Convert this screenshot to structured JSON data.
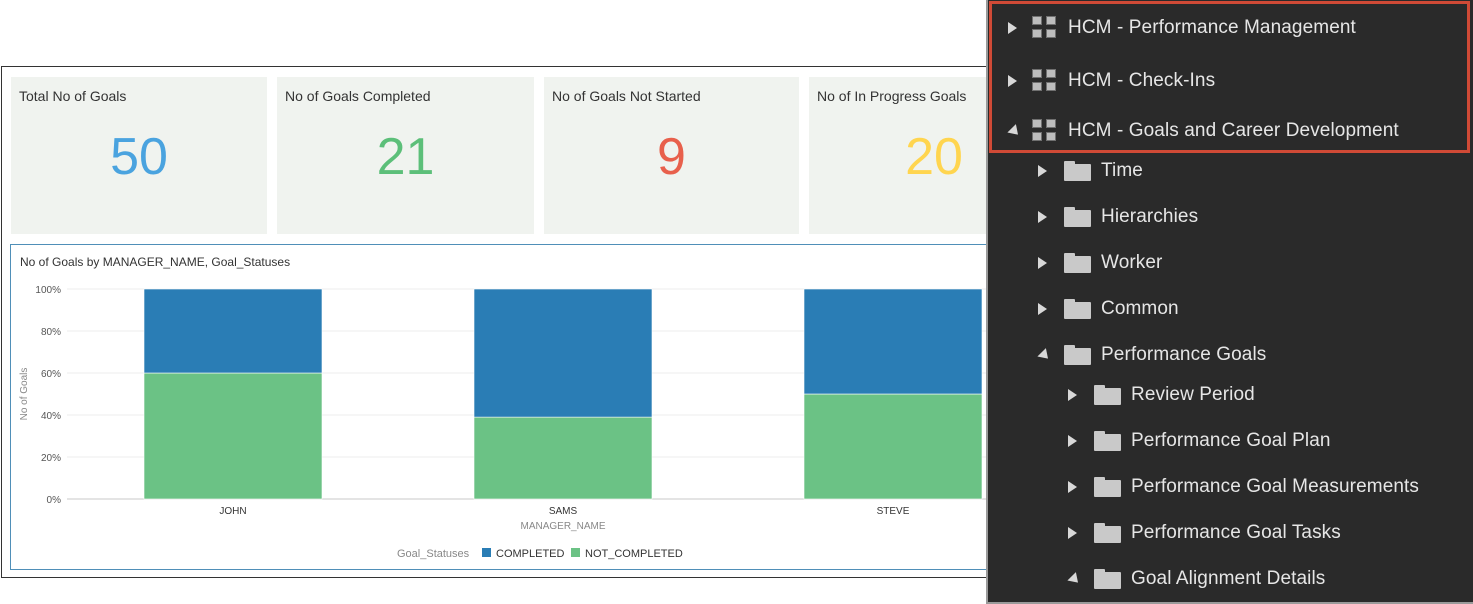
{
  "kpis": [
    {
      "title": "Total No of Goals",
      "value": "50"
    },
    {
      "title": "No of Goals Completed",
      "value": "21"
    },
    {
      "title": "No of Goals Not Started",
      "value": "9"
    },
    {
      "title": "No of In Progress Goals",
      "value": "20"
    }
  ],
  "colors": {
    "completed": "#2a7db5",
    "not_completed": "#6bc285",
    "total_goals": "#4aa3df",
    "goals_completed": "#5cbf79",
    "goals_not_started": "#e8604c",
    "in_progress": "#ffd54f",
    "highlight_border": "#d04a36"
  },
  "chart_data": {
    "type": "bar",
    "stacked": true,
    "title": "No of Goals by MANAGER_NAME, Goal_Statuses",
    "xlabel": "MANAGER_NAME",
    "ylabel": "No of Goals",
    "categories": [
      "JOHN",
      "SAMS",
      "STEVE"
    ],
    "series": [
      {
        "name": "NOT_COMPLETED",
        "values": [
          60,
          39,
          50
        ]
      },
      {
        "name": "COMPLETED",
        "values": [
          40,
          61,
          50
        ]
      }
    ],
    "ylim": [
      0,
      100
    ],
    "yticks": [
      "0%",
      "20%",
      "40%",
      "60%",
      "80%",
      "100%"
    ],
    "legend_title": "Goal_Statuses",
    "legend_position": "bottom",
    "grid": true
  },
  "tree": {
    "items": [
      {
        "label": "HCM - Performance Management",
        "icon": "subject-area-icon",
        "expanded": false,
        "level": 0
      },
      {
        "label": "HCM - Check-Ins",
        "icon": "subject-area-icon",
        "expanded": false,
        "level": 0
      },
      {
        "label": "HCM - Goals and Career Development",
        "icon": "subject-area-icon",
        "expanded": true,
        "level": 0
      },
      {
        "label": "Time",
        "icon": "folder-icon",
        "expanded": false,
        "level": 1
      },
      {
        "label": "Hierarchies",
        "icon": "folder-icon",
        "expanded": false,
        "level": 1
      },
      {
        "label": "Worker",
        "icon": "folder-icon",
        "expanded": false,
        "level": 1
      },
      {
        "label": "Common",
        "icon": "folder-icon",
        "expanded": false,
        "level": 1
      },
      {
        "label": "Performance Goals",
        "icon": "folder-icon",
        "expanded": true,
        "level": 1
      },
      {
        "label": "Review Period",
        "icon": "folder-icon",
        "expanded": false,
        "level": 2
      },
      {
        "label": "Performance Goal Plan",
        "icon": "folder-icon",
        "expanded": false,
        "level": 2
      },
      {
        "label": "Performance Goal Measurements",
        "icon": "folder-icon",
        "expanded": false,
        "level": 2
      },
      {
        "label": "Performance Goal Tasks",
        "icon": "folder-icon",
        "expanded": false,
        "level": 2
      },
      {
        "label": "Goal Alignment Details",
        "icon": "folder-icon",
        "expanded": true,
        "level": 2
      }
    ]
  }
}
